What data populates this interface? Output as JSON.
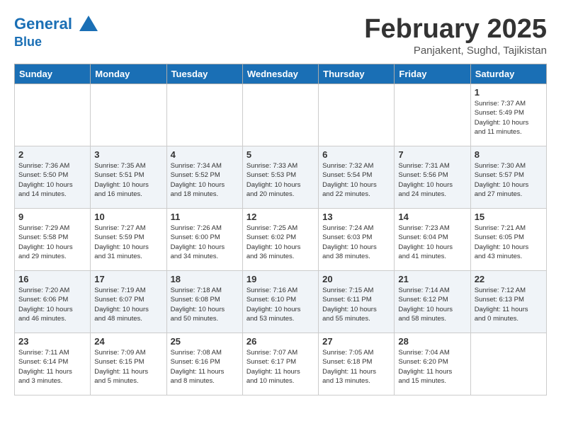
{
  "header": {
    "logo_line1": "General",
    "logo_line2": "Blue",
    "title": "February 2025",
    "subtitle": "Panjakent, Sughd, Tajikistan"
  },
  "weekdays": [
    "Sunday",
    "Monday",
    "Tuesday",
    "Wednesday",
    "Thursday",
    "Friday",
    "Saturday"
  ],
  "weeks": [
    [
      {
        "day": "",
        "info": ""
      },
      {
        "day": "",
        "info": ""
      },
      {
        "day": "",
        "info": ""
      },
      {
        "day": "",
        "info": ""
      },
      {
        "day": "",
        "info": ""
      },
      {
        "day": "",
        "info": ""
      },
      {
        "day": "1",
        "info": "Sunrise: 7:37 AM\nSunset: 5:49 PM\nDaylight: 10 hours\nand 11 minutes."
      }
    ],
    [
      {
        "day": "2",
        "info": "Sunrise: 7:36 AM\nSunset: 5:50 PM\nDaylight: 10 hours\nand 14 minutes."
      },
      {
        "day": "3",
        "info": "Sunrise: 7:35 AM\nSunset: 5:51 PM\nDaylight: 10 hours\nand 16 minutes."
      },
      {
        "day": "4",
        "info": "Sunrise: 7:34 AM\nSunset: 5:52 PM\nDaylight: 10 hours\nand 18 minutes."
      },
      {
        "day": "5",
        "info": "Sunrise: 7:33 AM\nSunset: 5:53 PM\nDaylight: 10 hours\nand 20 minutes."
      },
      {
        "day": "6",
        "info": "Sunrise: 7:32 AM\nSunset: 5:54 PM\nDaylight: 10 hours\nand 22 minutes."
      },
      {
        "day": "7",
        "info": "Sunrise: 7:31 AM\nSunset: 5:56 PM\nDaylight: 10 hours\nand 24 minutes."
      },
      {
        "day": "8",
        "info": "Sunrise: 7:30 AM\nSunset: 5:57 PM\nDaylight: 10 hours\nand 27 minutes."
      }
    ],
    [
      {
        "day": "9",
        "info": "Sunrise: 7:29 AM\nSunset: 5:58 PM\nDaylight: 10 hours\nand 29 minutes."
      },
      {
        "day": "10",
        "info": "Sunrise: 7:27 AM\nSunset: 5:59 PM\nDaylight: 10 hours\nand 31 minutes."
      },
      {
        "day": "11",
        "info": "Sunrise: 7:26 AM\nSunset: 6:00 PM\nDaylight: 10 hours\nand 34 minutes."
      },
      {
        "day": "12",
        "info": "Sunrise: 7:25 AM\nSunset: 6:02 PM\nDaylight: 10 hours\nand 36 minutes."
      },
      {
        "day": "13",
        "info": "Sunrise: 7:24 AM\nSunset: 6:03 PM\nDaylight: 10 hours\nand 38 minutes."
      },
      {
        "day": "14",
        "info": "Sunrise: 7:23 AM\nSunset: 6:04 PM\nDaylight: 10 hours\nand 41 minutes."
      },
      {
        "day": "15",
        "info": "Sunrise: 7:21 AM\nSunset: 6:05 PM\nDaylight: 10 hours\nand 43 minutes."
      }
    ],
    [
      {
        "day": "16",
        "info": "Sunrise: 7:20 AM\nSunset: 6:06 PM\nDaylight: 10 hours\nand 46 minutes."
      },
      {
        "day": "17",
        "info": "Sunrise: 7:19 AM\nSunset: 6:07 PM\nDaylight: 10 hours\nand 48 minutes."
      },
      {
        "day": "18",
        "info": "Sunrise: 7:18 AM\nSunset: 6:08 PM\nDaylight: 10 hours\nand 50 minutes."
      },
      {
        "day": "19",
        "info": "Sunrise: 7:16 AM\nSunset: 6:10 PM\nDaylight: 10 hours\nand 53 minutes."
      },
      {
        "day": "20",
        "info": "Sunrise: 7:15 AM\nSunset: 6:11 PM\nDaylight: 10 hours\nand 55 minutes."
      },
      {
        "day": "21",
        "info": "Sunrise: 7:14 AM\nSunset: 6:12 PM\nDaylight: 10 hours\nand 58 minutes."
      },
      {
        "day": "22",
        "info": "Sunrise: 7:12 AM\nSunset: 6:13 PM\nDaylight: 11 hours\nand 0 minutes."
      }
    ],
    [
      {
        "day": "23",
        "info": "Sunrise: 7:11 AM\nSunset: 6:14 PM\nDaylight: 11 hours\nand 3 minutes."
      },
      {
        "day": "24",
        "info": "Sunrise: 7:09 AM\nSunset: 6:15 PM\nDaylight: 11 hours\nand 5 minutes."
      },
      {
        "day": "25",
        "info": "Sunrise: 7:08 AM\nSunset: 6:16 PM\nDaylight: 11 hours\nand 8 minutes."
      },
      {
        "day": "26",
        "info": "Sunrise: 7:07 AM\nSunset: 6:17 PM\nDaylight: 11 hours\nand 10 minutes."
      },
      {
        "day": "27",
        "info": "Sunrise: 7:05 AM\nSunset: 6:18 PM\nDaylight: 11 hours\nand 13 minutes."
      },
      {
        "day": "28",
        "info": "Sunrise: 7:04 AM\nSunset: 6:20 PM\nDaylight: 11 hours\nand 15 minutes."
      },
      {
        "day": "",
        "info": ""
      }
    ]
  ]
}
